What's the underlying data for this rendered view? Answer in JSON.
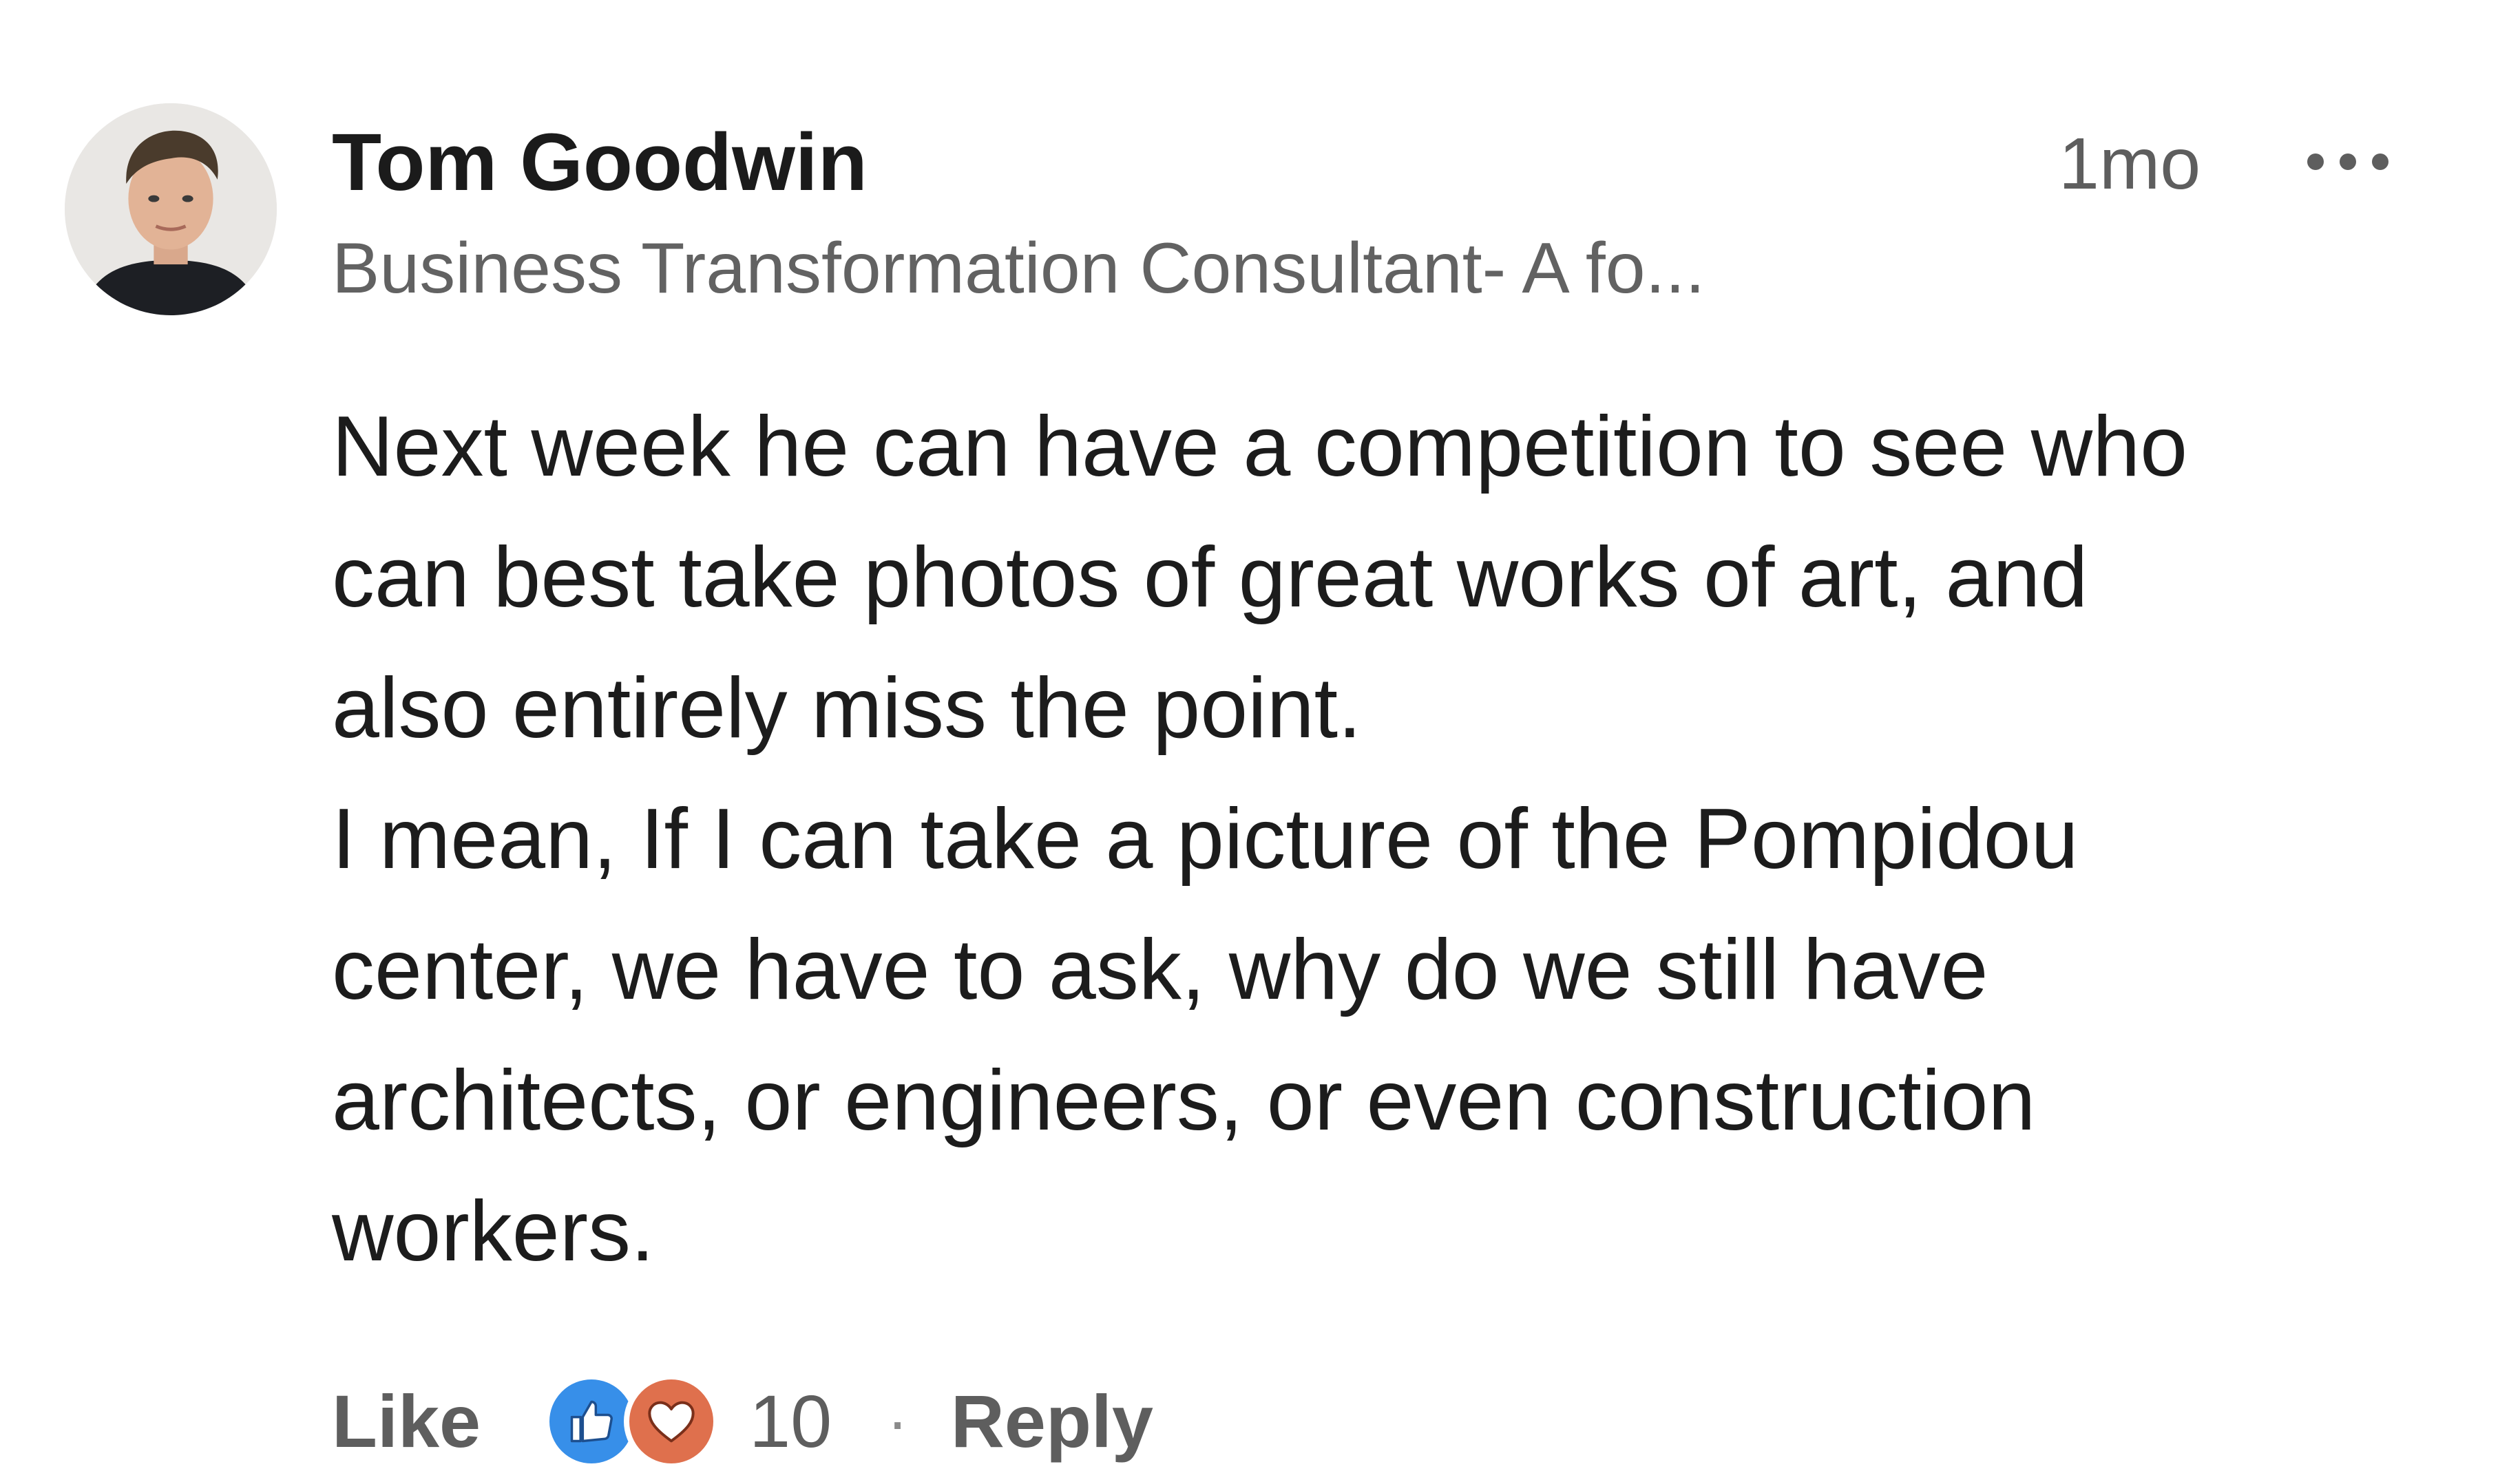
{
  "comment": {
    "author_name": "Tom Goodwin",
    "author_headline": "Business Transformation Consultant- A fo...",
    "timestamp": "1mo",
    "more_icon": "more-horizontal-icon",
    "avatar_icon": "profile-photo",
    "body_paragraphs": [
      "Next week he can have a competition to see who",
      "can best take photos of great works of art, and",
      "also entirely miss the point.",
      "I mean, If I can take a picture of the Pompidou",
      "center, we have to ask, why do we still have",
      "architects, or engineers, or even construction",
      "workers."
    ]
  },
  "actions": {
    "like_label": "Like",
    "reactions": [
      "like-reaction-icon",
      "love-reaction-icon"
    ],
    "reaction_count": "10",
    "separator": "·",
    "reply_label": "Reply"
  },
  "colors": {
    "like_reaction": "#378fe9",
    "love_reaction": "#df704d",
    "secondary_text": "#5e5e5e",
    "primary_text": "#1c1c1c"
  }
}
